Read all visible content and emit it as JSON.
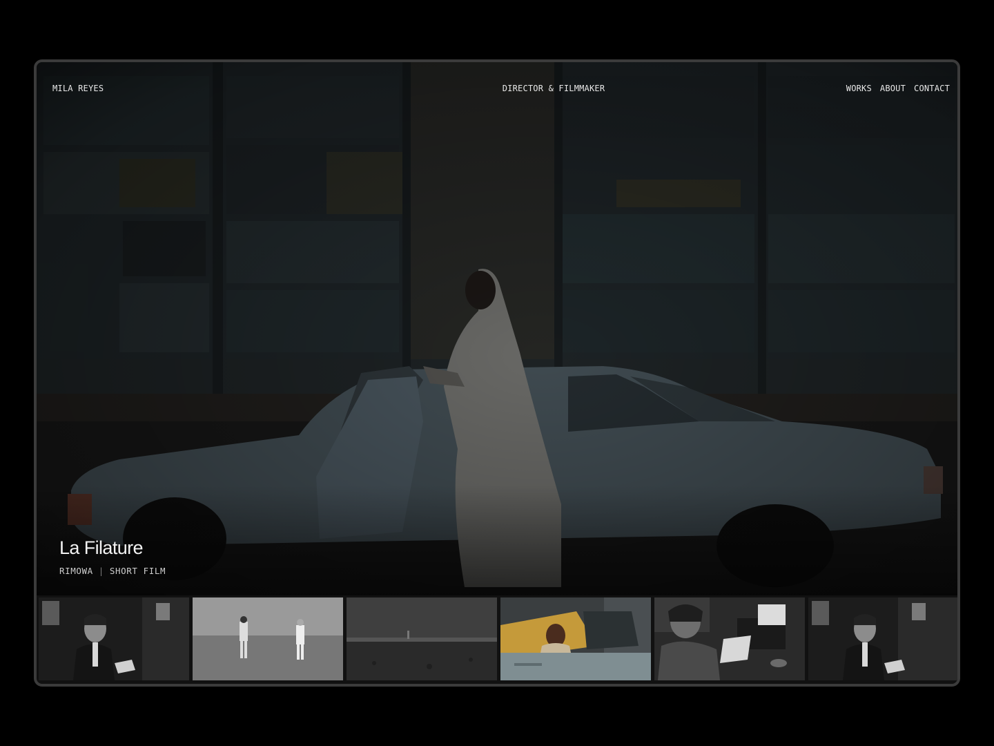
{
  "nav": {
    "brand": "MILA REYES",
    "tagline": "DIRECTOR & FILMMAKER",
    "links": [
      "WORKS",
      "ABOUT",
      "CONTACT"
    ]
  },
  "feature": {
    "title": "La Filature",
    "client": "RIMOWA",
    "separator": "|",
    "type": "SHORT FILM"
  },
  "thumbnails": [
    {
      "name": "thumb-man-in-suit",
      "active": false
    },
    {
      "name": "thumb-two-figures-field",
      "active": false
    },
    {
      "name": "thumb-barren-landscape",
      "active": false
    },
    {
      "name": "thumb-man-in-car",
      "active": true
    },
    {
      "name": "thumb-woman-typewriter",
      "active": false
    },
    {
      "name": "thumb-man-in-suit-repeat",
      "active": false
    }
  ],
  "colors": {
    "background": "#000000",
    "frame_border": "#3b3b3b",
    "text": "#e8e8e8"
  }
}
